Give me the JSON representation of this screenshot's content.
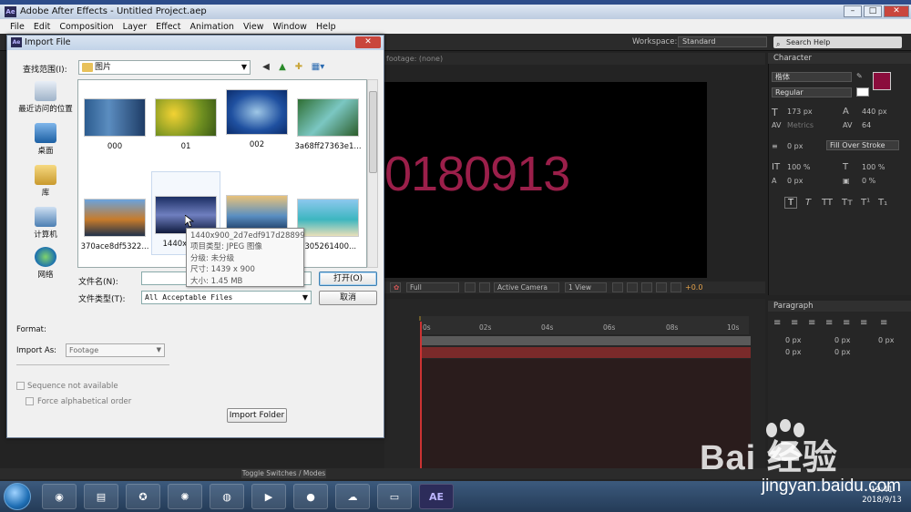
{
  "app": {
    "title": "Adobe After Effects - Untitled Project.aep",
    "logo_text": "Ae",
    "min": "–",
    "max": "□",
    "close": "✕"
  },
  "menu": [
    "File",
    "Edit",
    "Composition",
    "Layer",
    "Effect",
    "Animation",
    "View",
    "Window",
    "Help"
  ],
  "workspace": {
    "label": "Workspace:",
    "value": "Standard"
  },
  "search_help": "Search Help",
  "comp": {
    "tab": "footage: (none)",
    "viewer_text": "0180913"
  },
  "viewer_bar": {
    "zoom": "Full",
    "camera": "Active Camera",
    "views": "1 View",
    "offset": "+0.0"
  },
  "timeline": {
    "ticks": [
      "0s",
      "02s",
      "04s",
      "06s",
      "08s",
      "10s"
    ]
  },
  "character": {
    "title": "Character",
    "font": "楷体",
    "style": "Regular",
    "size": "173 px",
    "leading": "440 px",
    "kerning": "Metrics",
    "tracking": "64",
    "stroke": "0 px",
    "stroke_mode": "Fill Over Stroke",
    "vscale": "100 %",
    "hscale": "100 %",
    "baseline": "0 px",
    "tsume": "0 %",
    "styles": [
      "T",
      "T",
      "TT",
      "Tт",
      "T¹",
      "T₁"
    ],
    "fill_color": "#8b0d3d"
  },
  "paragraph": {
    "title": "Paragraph",
    "v1": "0 px",
    "v2": "0 px",
    "v3": "0 px",
    "v4": "0 px",
    "v5": "0 px"
  },
  "toggle": "Toggle Switches / Modes",
  "clock": {
    "time": "19:41",
    "date": "2018/9/13"
  },
  "taskbar": {
    "ae": "AE"
  },
  "dialog": {
    "title": "Import File",
    "look_in_label": "查找范围(I):",
    "look_in_value": "图片",
    "places": [
      "最近访问的位置",
      "桌面",
      "库",
      "计算机",
      "网络"
    ],
    "files": [
      {
        "name": "000"
      },
      {
        "name": "01"
      },
      {
        "name": "002"
      },
      {
        "name": "3a68ff27363e1..."
      },
      {
        "name": "370ace8df5322..."
      },
      {
        "name": "1440x900..."
      },
      {
        "name": ""
      },
      {
        "name": "1305261400..."
      }
    ],
    "file_name_label": "文件名(N):",
    "file_name_value": "",
    "file_type_label": "文件类型(T):",
    "file_type_value": "All Acceptable Files",
    "open_btn": "打开(O)",
    "cancel_btn": "取消",
    "format_label": "Format:",
    "import_as_label": "Import As:",
    "import_as_value": "Footage",
    "sequence_label": "Sequence not available",
    "alpha_label": "Force alphabetical order",
    "import_folder_btn": "Import Folder",
    "tooltip": {
      "line1": "1440x900_2d7edf917d28899",
      "line2": "项目类型: JPEG 图像",
      "line3": "分级: 未分级",
      "line4": "尺寸: 1439 x 900",
      "line5": "大小: 1.45 MB"
    }
  },
  "watermark": {
    "text": "Bai  经验",
    "sub": "jingyan.baidu.com"
  }
}
